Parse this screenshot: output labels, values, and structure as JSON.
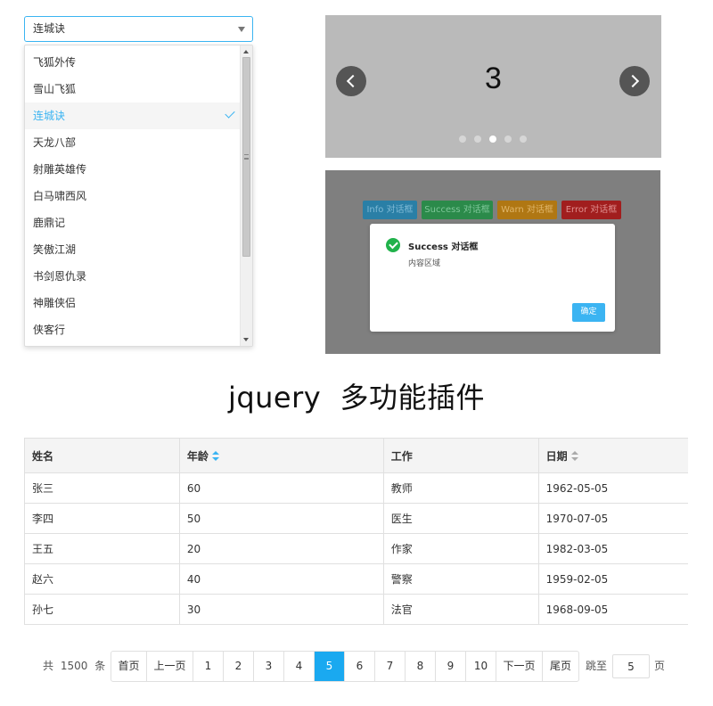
{
  "select": {
    "value": "连城诀",
    "options": [
      "飞狐外传",
      "雪山飞狐",
      "连城诀",
      "天龙八部",
      "射雕英雄传",
      "白马啸西风",
      "鹿鼎记",
      "笑傲江湖",
      "书剑恩仇录",
      "神雕侠侣",
      "侠客行"
    ],
    "selected_index": 2
  },
  "carousel": {
    "current_slide": "3",
    "dot_count": 5,
    "active_dot": 3
  },
  "dialog_demo": {
    "buttons": {
      "info": "Info 对话框",
      "success": "Success 对话框",
      "warn": "Warn 对话框",
      "error": "Error 对话框"
    },
    "modal": {
      "title": "Success 对话框",
      "content": "内容区域",
      "ok_label": "确定"
    }
  },
  "page_title": "jquery  多功能插件",
  "table": {
    "headers": {
      "name": "姓名",
      "age": "年龄",
      "job": "工作",
      "date": "日期"
    },
    "rows": [
      {
        "name": "张三",
        "age": "60",
        "job": "教师",
        "date": "1962-05-05"
      },
      {
        "name": "李四",
        "age": "50",
        "job": "医生",
        "date": "1970-07-05"
      },
      {
        "name": "王五",
        "age": "20",
        "job": "作家",
        "date": "1982-03-05"
      },
      {
        "name": "赵六",
        "age": "40",
        "job": "警察",
        "date": "1959-02-05"
      },
      {
        "name": "孙七",
        "age": "30",
        "job": "法官",
        "date": "1968-09-05"
      }
    ]
  },
  "pagination": {
    "total_prefix": "共",
    "total": "1500",
    "total_suffix": "条",
    "first": "首页",
    "prev": "上一页",
    "pages": [
      "1",
      "2",
      "3",
      "4",
      "5",
      "6",
      "7",
      "8",
      "9",
      "10"
    ],
    "current_page": "5",
    "next": "下一页",
    "last": "尾页",
    "jump_label": "跳至",
    "jump_value": "5",
    "jump_unit": "页"
  },
  "colors": {
    "accent": "#3bb4f2",
    "success": "#21b24b"
  }
}
